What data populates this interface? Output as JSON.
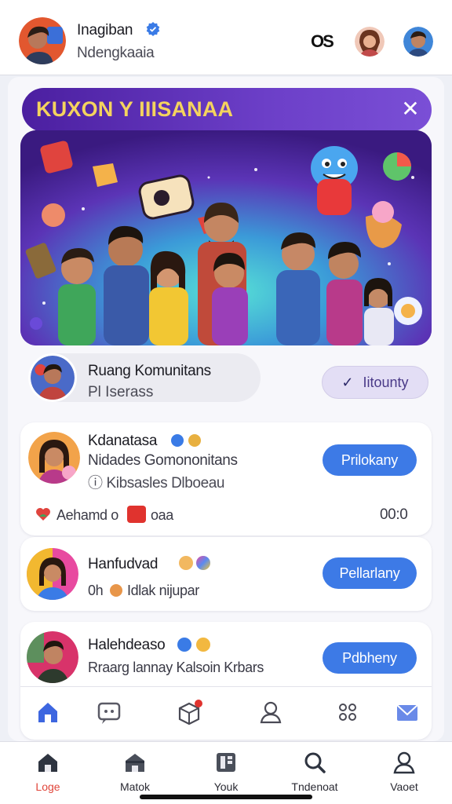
{
  "header": {
    "name": "Inagiban",
    "subtitle": "Ndengkaaia",
    "os_label": "OS",
    "icons": {
      "verified": "verified-badge-icon"
    }
  },
  "banner": {
    "title": "KUXON Y IIISANAA",
    "close_icon": "close-icon",
    "colors": {
      "title": "#f4d35e",
      "bar": "#5a2db4"
    }
  },
  "community": {
    "title": "Ruang Komunitans",
    "subtitle": "Pl Iserass",
    "follow_label": "Iitounty",
    "follow_icon": "check-icon"
  },
  "cards": [
    {
      "name": "Kdanatasa",
      "line1": "Nidades Gomononitans",
      "line2": "Kibsasles Dlboeau",
      "line2_icon": "info-circle-icon",
      "button": "Prilokany",
      "footer_left": "Aehamd o",
      "footer_mid": "oaa",
      "footer_right": "00:0"
    },
    {
      "name": "Hanfudvad",
      "line1_prefix": "0h",
      "line1": "Idlak nijupar",
      "button": "Pellarlany"
    },
    {
      "name": "Halehdeaso",
      "line1": "Rraarg lannay Kalsoin Krbars",
      "button": "Pdbheny"
    }
  ],
  "inner_icons": [
    "home-icon",
    "chat-icon",
    "box-icon",
    "profile-icon",
    "settings-icon",
    "mail-icon"
  ],
  "bottom_nav": [
    {
      "label": "Loge",
      "icon": "home-icon",
      "active": true
    },
    {
      "label": "Matok",
      "icon": "store-icon",
      "active": false
    },
    {
      "label": "Youk",
      "icon": "book-icon",
      "active": false
    },
    {
      "label": "Tndenoat",
      "icon": "search-icon",
      "active": false
    },
    {
      "label": "Vaoet",
      "icon": "profile-icon",
      "active": false
    }
  ],
  "colors": {
    "accent": "#3d7ae6",
    "active_nav": "#e0453a"
  }
}
